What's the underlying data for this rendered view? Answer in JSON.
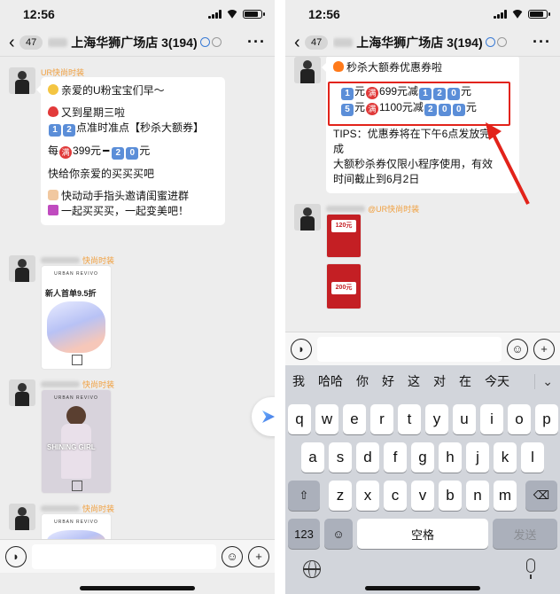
{
  "left": {
    "status": {
      "time": "12:56"
    },
    "nav": {
      "unread": "47",
      "title": "上海华狮广场店 3(194)"
    },
    "messages": [
      {
        "sender": "UR快尚时装",
        "lines": [
          "亲爱的U粉宝宝们早～",
          "",
          "又到星期三啦",
          "点准时准点【秒杀大额券】",
          "",
          "每",
          "399元",
          "元",
          "",
          "快给你亲爱的买买买吧",
          "",
          "快动动手指头邀请闺蜜进群",
          "一起买买买，一起变美吧！"
        ],
        "keycaps_time": [
          "1",
          "2"
        ],
        "keycaps_amount": [
          "2",
          "0"
        ],
        "man": "满"
      },
      {
        "sender": "快尚时装",
        "poster_brand": "URBAN REVIVO",
        "poster_title": "新人首单9.5折"
      },
      {
        "sender": "快尚时装",
        "poster_brand": "URBAN REVIVO",
        "poster_title": "SHINING GIRL"
      },
      {
        "sender": "快尚时装",
        "poster_brand": "URBAN REVIVO"
      }
    ]
  },
  "right": {
    "status": {
      "time": "12:56"
    },
    "nav": {
      "unread": "47",
      "title": "上海华狮广场店 3(194)"
    },
    "coupon_message": {
      "title": "秒杀大额券优惠券啦",
      "row1": {
        "lead": "1",
        "text1": "元",
        "man": "满",
        "text2": "699元减",
        "k1": "1",
        "k2": "2",
        "k3": "0",
        "text3": "元"
      },
      "row2": {
        "lead": "5",
        "text1": "元",
        "man": "满",
        "text2": "1100元减",
        "k1": "2",
        "k2": "0",
        "k3": "0",
        "text3": "元"
      },
      "tips": [
        "TIPS：优惠券将在下午6点发放完",
        "成",
        "大额秒杀券仅限小程序使用，有效",
        "时间截止到6月2日"
      ]
    },
    "second_message": {
      "sender": "@UR快尚时装",
      "coupon1": "120元",
      "coupon2": "200元"
    },
    "candidates": [
      "我",
      "哈哈",
      "你",
      "好",
      "这",
      "对",
      "在",
      "今天"
    ],
    "keys_row1": [
      "q",
      "w",
      "e",
      "r",
      "t",
      "y",
      "u",
      "i",
      "o",
      "p"
    ],
    "keys_row2": [
      "a",
      "s",
      "d",
      "f",
      "g",
      "h",
      "j",
      "k",
      "l"
    ],
    "keys_row3": [
      "z",
      "x",
      "c",
      "v",
      "b",
      "n",
      "m"
    ],
    "key_123": "123",
    "key_space": "空格",
    "key_send": "发送"
  }
}
